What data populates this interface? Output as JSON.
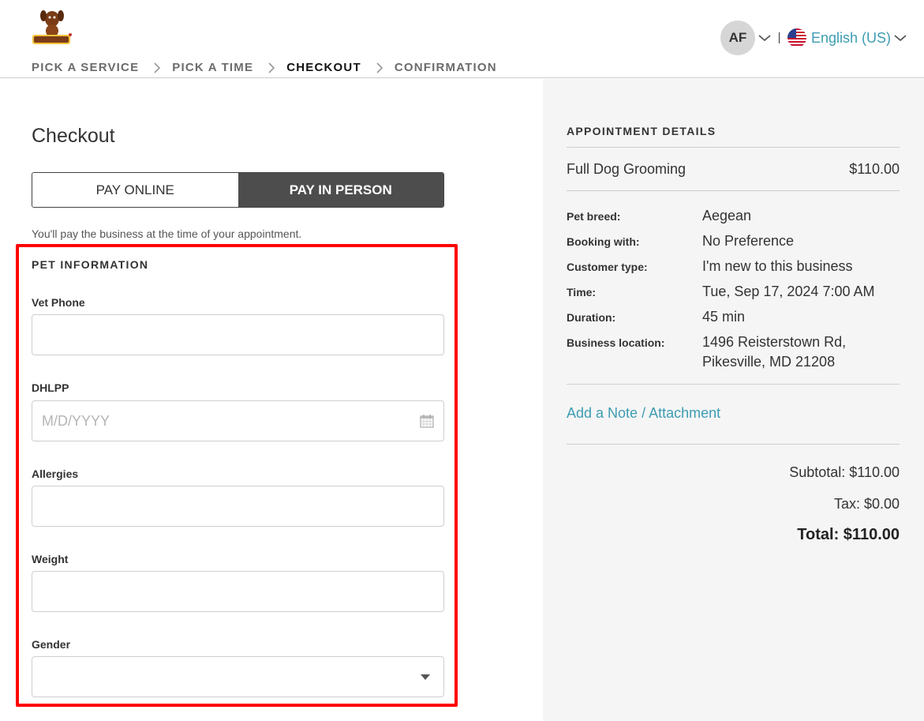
{
  "header": {
    "logo_alt": "Pets R Us",
    "user_initials": "AF",
    "language": "English (US)"
  },
  "steps": [
    {
      "label": "PICK A SERVICE"
    },
    {
      "label": "PICK A TIME"
    },
    {
      "label": "CHECKOUT"
    },
    {
      "label": "CONFIRMATION"
    }
  ],
  "checkout": {
    "title": "Checkout",
    "pay_online": "PAY ONLINE",
    "pay_in_person": "PAY IN PERSON",
    "pay_note": "You'll pay the business at the time of your appointment.",
    "section_title": "PET INFORMATION",
    "fields": {
      "vet_phone": {
        "label": "Vet Phone",
        "value": ""
      },
      "dhlpp": {
        "label": "DHLPP",
        "placeholder": "M/D/YYYY"
      },
      "allergies": {
        "label": "Allergies",
        "value": ""
      },
      "weight": {
        "label": "Weight",
        "value": ""
      },
      "gender": {
        "label": "Gender",
        "value": ""
      }
    }
  },
  "appointment": {
    "title": "APPOINTMENT DETAILS",
    "service_name": "Full Dog Grooming",
    "service_price": "$110.00",
    "details": [
      {
        "label": "Pet breed:",
        "value": "Aegean"
      },
      {
        "label": "Booking with:",
        "value": "No Preference"
      },
      {
        "label": "Customer type:",
        "value": "I'm new to this business"
      },
      {
        "label": "Time:",
        "value": "Tue, Sep 17, 2024 7:00 AM"
      },
      {
        "label": "Duration:",
        "value": "45 min"
      },
      {
        "label": "Business location:",
        "value_line1": "1496 Reisterstown Rd,",
        "value_line2": "Pikesville, MD 21208"
      }
    ],
    "note_link": "Add a Note / Attachment",
    "subtotal": "Subtotal: $110.00",
    "tax": "Tax: $0.00",
    "total": "Total: $110.00"
  },
  "colors": {
    "link": "#3d9cb2",
    "active_toggle": "#4d4d4d",
    "highlight": "#ff0000",
    "panel_bg": "#f5f5f5"
  }
}
